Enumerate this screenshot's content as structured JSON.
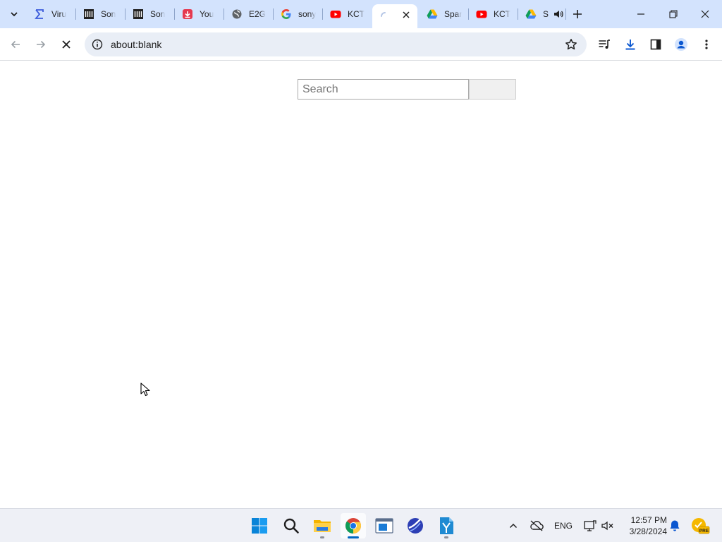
{
  "tabs": [
    {
      "title": "Viru",
      "icon": "sigma-icon"
    },
    {
      "title": "Son",
      "icon": "library-icon"
    },
    {
      "title": "Son",
      "icon": "library-icon"
    },
    {
      "title": "You",
      "icon": "download-red-icon"
    },
    {
      "title": "E2G",
      "icon": "globe-icon"
    },
    {
      "title": "sony",
      "icon": "google-icon"
    },
    {
      "title": "KCT",
      "icon": "youtube-icon"
    },
    {
      "title": "",
      "icon": "loading-spinner-icon",
      "active": true
    },
    {
      "title": "Spar",
      "icon": "google-drive-icon"
    },
    {
      "title": "KCT",
      "icon": "youtube-icon"
    },
    {
      "title": "S",
      "icon": "google-drive-icon",
      "audio": true
    }
  ],
  "address_bar": {
    "url": "about:blank"
  },
  "page": {
    "search_placeholder": "Search",
    "search_button_label": ""
  },
  "taskbar": {
    "language": "ENG",
    "time": "12:57 PM",
    "date": "3/28/2024",
    "badge": "PRE"
  },
  "colors": {
    "tabstrip_bg": "#d3e3fd",
    "omnibox_bg": "#e9eef6",
    "accent_blue": "#0b57d0",
    "taskbar_bg": "#eef0f6",
    "youtube_red": "#ff0000"
  }
}
